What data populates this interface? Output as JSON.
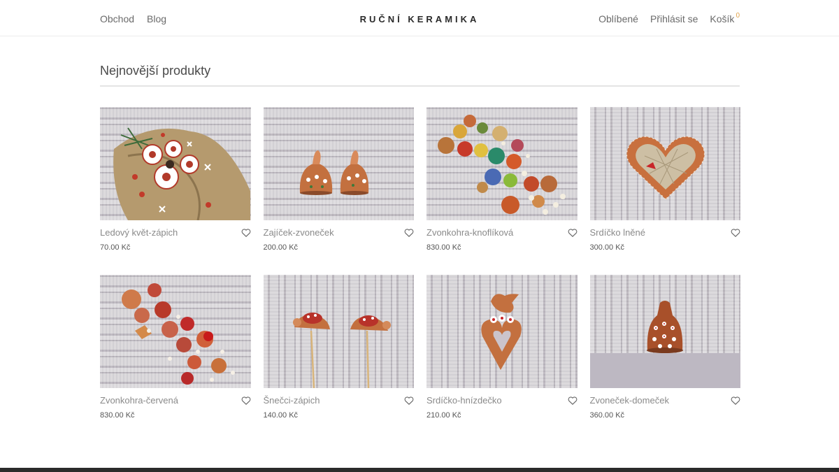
{
  "header": {
    "nav_left": [
      "Obchod",
      "Blog"
    ],
    "logo": "RUČNÍ KERAMIKA",
    "favorites": "Oblíbené",
    "login": "Přihlásit se",
    "cart": "Košík",
    "cart_count": "0"
  },
  "section": {
    "title": "Nejnovější produkty"
  },
  "products": [
    {
      "name": "Ledový květ-zápich",
      "price": "70.00 Kč",
      "icon": "heart-icon"
    },
    {
      "name": "Zajíček-zvoneček",
      "price": "200.00 Kč",
      "icon": "heart-icon"
    },
    {
      "name": "Zvonkohra-knoflíková",
      "price": "830.00 Kč",
      "icon": "heart-icon"
    },
    {
      "name": "Srdíčko lněné",
      "price": "300.00 Kč",
      "icon": "heart-icon"
    },
    {
      "name": "Zvonkohra-červená",
      "price": "830.00 Kč",
      "icon": "heart-icon"
    },
    {
      "name": "Šnečci-zápich",
      "price": "140.00 Kč",
      "icon": "heart-icon"
    },
    {
      "name": "Srdíčko-hnízdečko",
      "price": "210.00 Kč",
      "icon": "heart-icon"
    },
    {
      "name": "Zvoneček-domeček",
      "price": "360.00 Kč",
      "icon": "heart-icon"
    }
  ],
  "colors": {
    "accent": "#e0a24a",
    "footer": "#2b2b2b",
    "clay": "#c06a3a"
  }
}
